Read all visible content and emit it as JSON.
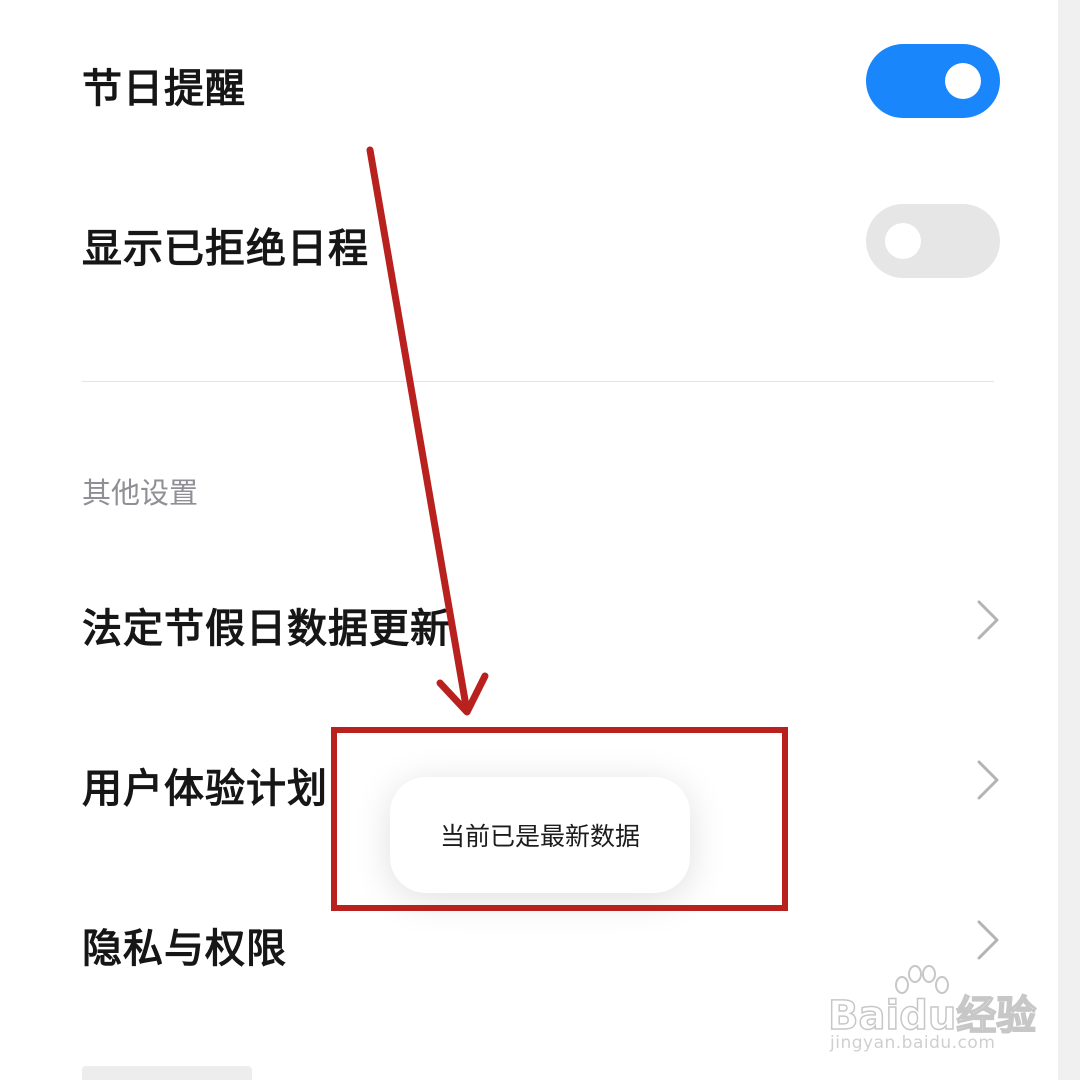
{
  "settings": {
    "holiday_reminder": {
      "label": "节日提醒",
      "enabled": true
    },
    "show_declined_events": {
      "label": "显示已拒绝日程",
      "enabled": false
    }
  },
  "other_settings": {
    "header": "其他设置",
    "items": [
      {
        "label": "法定节假日数据更新",
        "icon": "chevron-right-icon"
      },
      {
        "label": "用户体验计划",
        "icon": "chevron-right-icon"
      },
      {
        "label": "隐私与权限",
        "icon": "chevron-right-icon"
      }
    ]
  },
  "toast": {
    "message": "当前已是最新数据"
  },
  "watermark": {
    "brand": "Baidu经验",
    "url": "jingyan.baidu.com"
  },
  "colors": {
    "accent": "#1a86fb",
    "toggle_off": "#e6e6e6",
    "annotation": "#b8211d",
    "section_header": "#8f8f95"
  }
}
